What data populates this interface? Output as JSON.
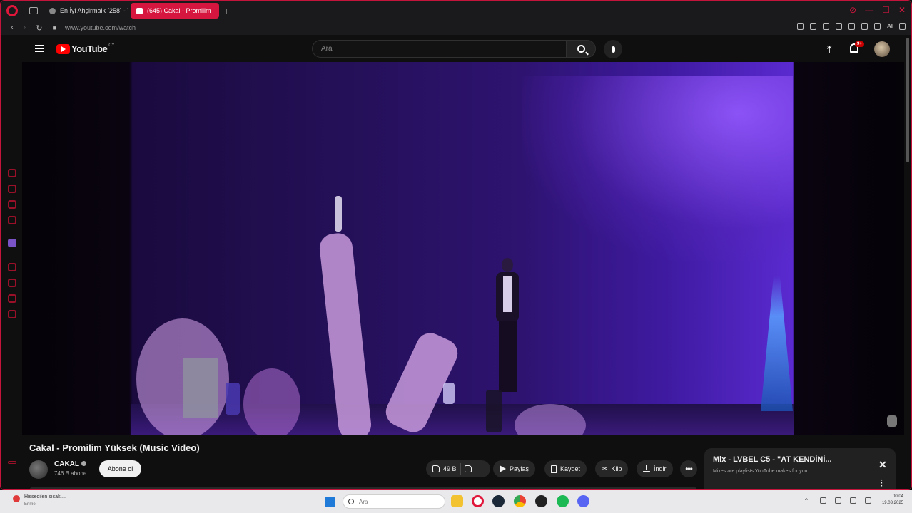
{
  "browser": {
    "tabs": [
      {
        "label": "En İyi Ahşirmaik [258] - T",
        "active": false
      },
      {
        "label": "(645) Cakal - Promilim",
        "active": true
      }
    ],
    "url": "www.youtube.com/watch",
    "ai_label": "AI",
    "accent_color": "#d6163e"
  },
  "youtube": {
    "logo_text": "YouTube",
    "logo_country": "CY",
    "search_placeholder": "Ara",
    "notifications_badge": "9+"
  },
  "video": {
    "title": "Cakal - Promilim Yüksek (Music Video)",
    "channel_name": "CAKAL",
    "subscribers": "746 B abone",
    "subscribe_label": "Abone ol",
    "likes": "49 B",
    "share_label": "Paylaş",
    "save_label": "Kaydet",
    "clip_label": "Klip",
    "download_label": "İndir",
    "more_label": "•••"
  },
  "mix_card": {
    "title": "Mix - LVBEL C5 - \"AT KENDİNİ...",
    "subtitle": "Mixes are playlists YouTube makes for you",
    "close_label": "✕"
  },
  "taskbar": {
    "weather_title": "Hissedilen sıcakl...",
    "weather_sub": "Erimel",
    "search_placeholder": "Ara",
    "time": "00:04",
    "date": "19.03.2025"
  }
}
